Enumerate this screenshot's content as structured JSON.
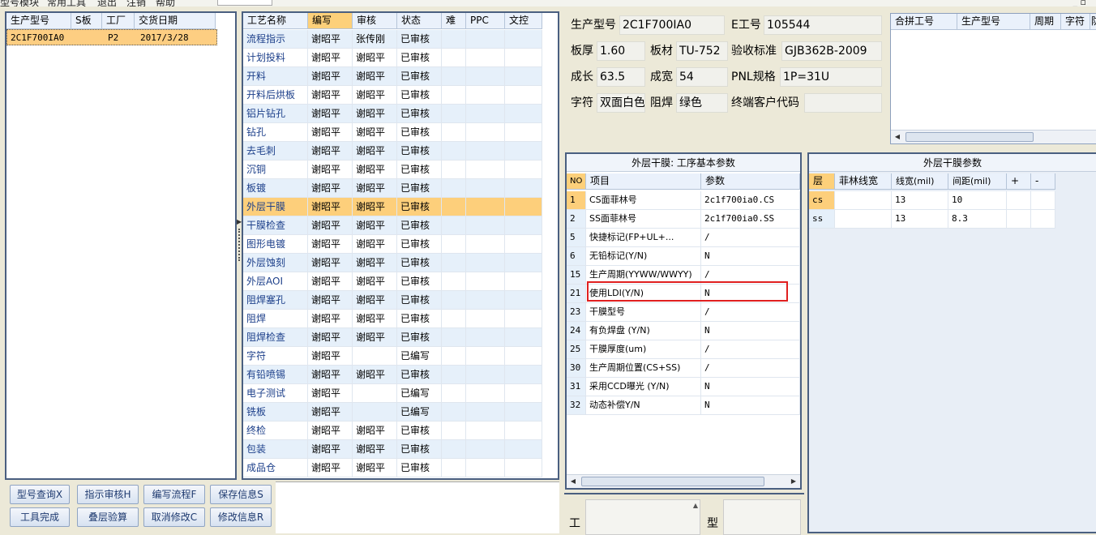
{
  "menu": {
    "items": [
      "型号模块",
      "常用工具",
      "退出",
      "注销",
      "帮助"
    ],
    "right_icons": "_ ▫"
  },
  "left_grid": {
    "headers": [
      "生产型号",
      "S板",
      "工厂",
      "交货日期"
    ],
    "rows": [
      {
        "model": "2C1F700IA0",
        "s": "",
        "factory": "P2",
        "date": "2017/3/28"
      }
    ]
  },
  "buttons": {
    "query": "型号查询X",
    "audit": "指示审核H",
    "edit_flow": "编写流程F",
    "save_info": "保存信息S",
    "tool_done": "工具完成",
    "stack_calc": "叠层验算",
    "cancel_edit": "取消修改C",
    "modify_info": "修改信息R"
  },
  "process_grid": {
    "headers": [
      "工艺名称",
      "编写",
      "审核",
      "状态",
      "难",
      "PPC",
      "文控"
    ],
    "rows": [
      {
        "name": "流程指示",
        "writer": "谢昭平",
        "auditor": "张传刚",
        "status": "已审核"
      },
      {
        "name": "计划投料",
        "writer": "谢昭平",
        "auditor": "谢昭平",
        "status": "已审核"
      },
      {
        "name": "开料",
        "writer": "谢昭平",
        "auditor": "谢昭平",
        "status": "已审核"
      },
      {
        "name": "开料后烘板",
        "writer": "谢昭平",
        "auditor": "谢昭平",
        "status": "已审核"
      },
      {
        "name": "铝片钻孔",
        "writer": "谢昭平",
        "auditor": "谢昭平",
        "status": "已审核"
      },
      {
        "name": "钻孔",
        "writer": "谢昭平",
        "auditor": "谢昭平",
        "status": "已审核"
      },
      {
        "name": "去毛刺",
        "writer": "谢昭平",
        "auditor": "谢昭平",
        "status": "已审核"
      },
      {
        "name": "沉铜",
        "writer": "谢昭平",
        "auditor": "谢昭平",
        "status": "已审核"
      },
      {
        "name": "板镀",
        "writer": "谢昭平",
        "auditor": "谢昭平",
        "status": "已审核"
      },
      {
        "name": "外层干膜",
        "writer": "谢昭平",
        "auditor": "谢昭平",
        "status": "已审核"
      },
      {
        "name": "干膜检查",
        "writer": "谢昭平",
        "auditor": "谢昭平",
        "status": "已审核"
      },
      {
        "name": "图形电镀",
        "writer": "谢昭平",
        "auditor": "谢昭平",
        "status": "已审核"
      },
      {
        "name": "外层蚀刻",
        "writer": "谢昭平",
        "auditor": "谢昭平",
        "status": "已审核"
      },
      {
        "name": "外层AOI",
        "writer": "谢昭平",
        "auditor": "谢昭平",
        "status": "已审核"
      },
      {
        "name": "阻焊塞孔",
        "writer": "谢昭平",
        "auditor": "谢昭平",
        "status": "已审核"
      },
      {
        "name": "阻焊",
        "writer": "谢昭平",
        "auditor": "谢昭平",
        "status": "已审核"
      },
      {
        "name": "阻焊检查",
        "writer": "谢昭平",
        "auditor": "谢昭平",
        "status": "已审核"
      },
      {
        "name": "字符",
        "writer": "谢昭平",
        "auditor": "",
        "status": "已编写"
      },
      {
        "name": "有铅喷锡",
        "writer": "谢昭平",
        "auditor": "谢昭平",
        "status": "已审核"
      },
      {
        "name": "电子测试",
        "writer": "谢昭平",
        "auditor": "",
        "status": "已编写"
      },
      {
        "name": "铣板",
        "writer": "谢昭平",
        "auditor": "",
        "status": "已编写"
      },
      {
        "name": "终检",
        "writer": "谢昭平",
        "auditor": "谢昭平",
        "status": "已审核"
      },
      {
        "name": "包装",
        "writer": "谢昭平",
        "auditor": "谢昭平",
        "status": "已审核"
      },
      {
        "name": "成品仓",
        "writer": "谢昭平",
        "auditor": "谢昭平",
        "status": "已审核"
      }
    ]
  },
  "info": {
    "model_label": "生产型号",
    "model": "2C1F700IA0",
    "eno_label": "E工号",
    "eno": "105544",
    "thick_label": "板厚",
    "thick": "1.60",
    "material_label": "板材",
    "material": "TU-752",
    "std_label": "验收标准",
    "std": "GJB362B-2009",
    "len_label": "成长",
    "len": "63.5",
    "wid_label": "成宽",
    "wid": "54",
    "pnl_label": "PNL规格",
    "pnl": "1P=31U",
    "char_label": "字符",
    "char": "双面白色",
    "mask_label": "阻焊",
    "mask": "绿色",
    "client_label": "终端客户代码",
    "client": ""
  },
  "combine_grid": {
    "headers": [
      "合拼工号",
      "生产型号",
      "周期",
      "字符",
      "防"
    ]
  },
  "param_grid": {
    "title": "外层干膜: 工序基本参数",
    "headers": [
      "NO",
      "项目",
      "参数"
    ],
    "rows": [
      {
        "no": "1",
        "item": "CS面菲林号",
        "value": "2c1f700ia0.CS"
      },
      {
        "no": "2",
        "item": "SS面菲林号",
        "value": "2c1f700ia0.SS"
      },
      {
        "no": "5",
        "item": "快捷标记(FP+UL+...",
        "value": "/"
      },
      {
        "no": "6",
        "item": "无铅标记(Y/N)",
        "value": "N"
      },
      {
        "no": "15",
        "item": "生产周期(YYWW/WWYY)",
        "value": "/"
      },
      {
        "no": "21",
        "item": "使用LDI(Y/N)",
        "value": "N"
      },
      {
        "no": "23",
        "item": "干膜型号",
        "value": "/"
      },
      {
        "no": "24",
        "item": "有负焊盘 (Y/N)",
        "value": "N"
      },
      {
        "no": "25",
        "item": "干膜厚度(um)",
        "value": "/"
      },
      {
        "no": "30",
        "item": "生产周期位置(CS+SS)",
        "value": "/"
      },
      {
        "no": "31",
        "item": "采用CCD曝光 (Y/N)",
        "value": "N"
      },
      {
        "no": "32",
        "item": "动态补偿Y/N",
        "value": "N"
      }
    ]
  },
  "dryfilm_grid": {
    "title": "外层干膜参数",
    "headers": [
      "层",
      "菲林线宽",
      "线宽(mil)",
      "间距(mil)",
      "+",
      "-"
    ],
    "rows": [
      {
        "layer": "cs",
        "film": "",
        "lw": "13",
        "sp": "10"
      },
      {
        "layer": "ss",
        "film": "",
        "lw": "13",
        "sp": "8.3"
      }
    ]
  },
  "bottom": {
    "gong_label": "工",
    "xing_label": "型"
  }
}
